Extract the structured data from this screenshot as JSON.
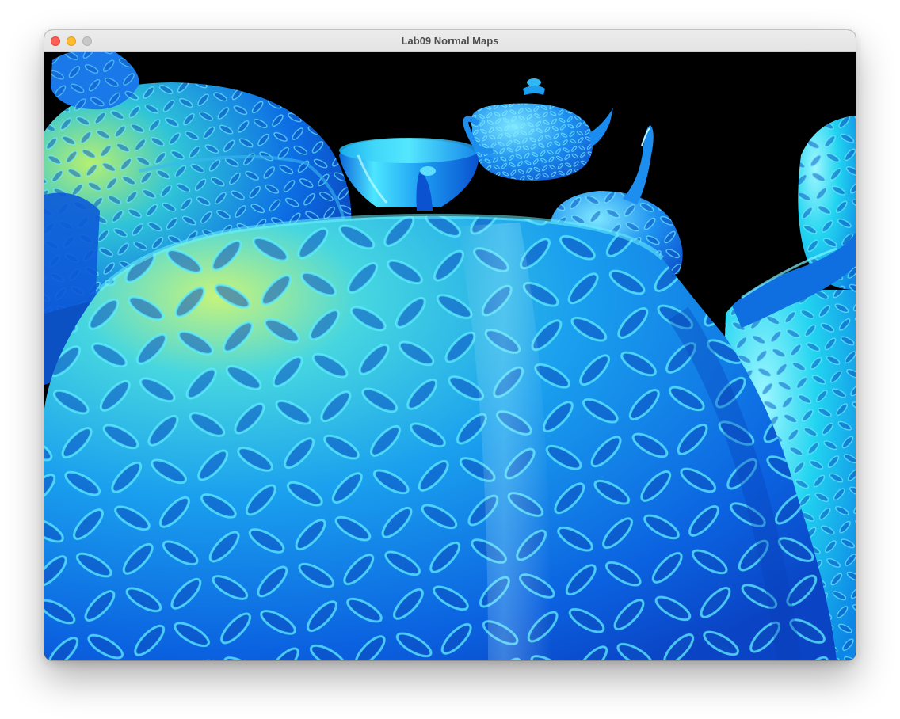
{
  "window": {
    "title": "Lab09 Normal Maps"
  },
  "titlebar": {
    "buttons": [
      {
        "name": "close",
        "color": "#fe5f57"
      },
      {
        "name": "minimize",
        "color": "#febc2e"
      },
      {
        "name": "zoom",
        "color": "#c8c8c8"
      }
    ]
  },
  "scene": {
    "background": "#000000",
    "object": "teapots",
    "texture": "diamond-plate normal map",
    "colors": {
      "deep": "#0a4fd6",
      "mid": "#1a8cf0",
      "cyan": "#21d6f2",
      "highlight": "#a8f060"
    }
  }
}
